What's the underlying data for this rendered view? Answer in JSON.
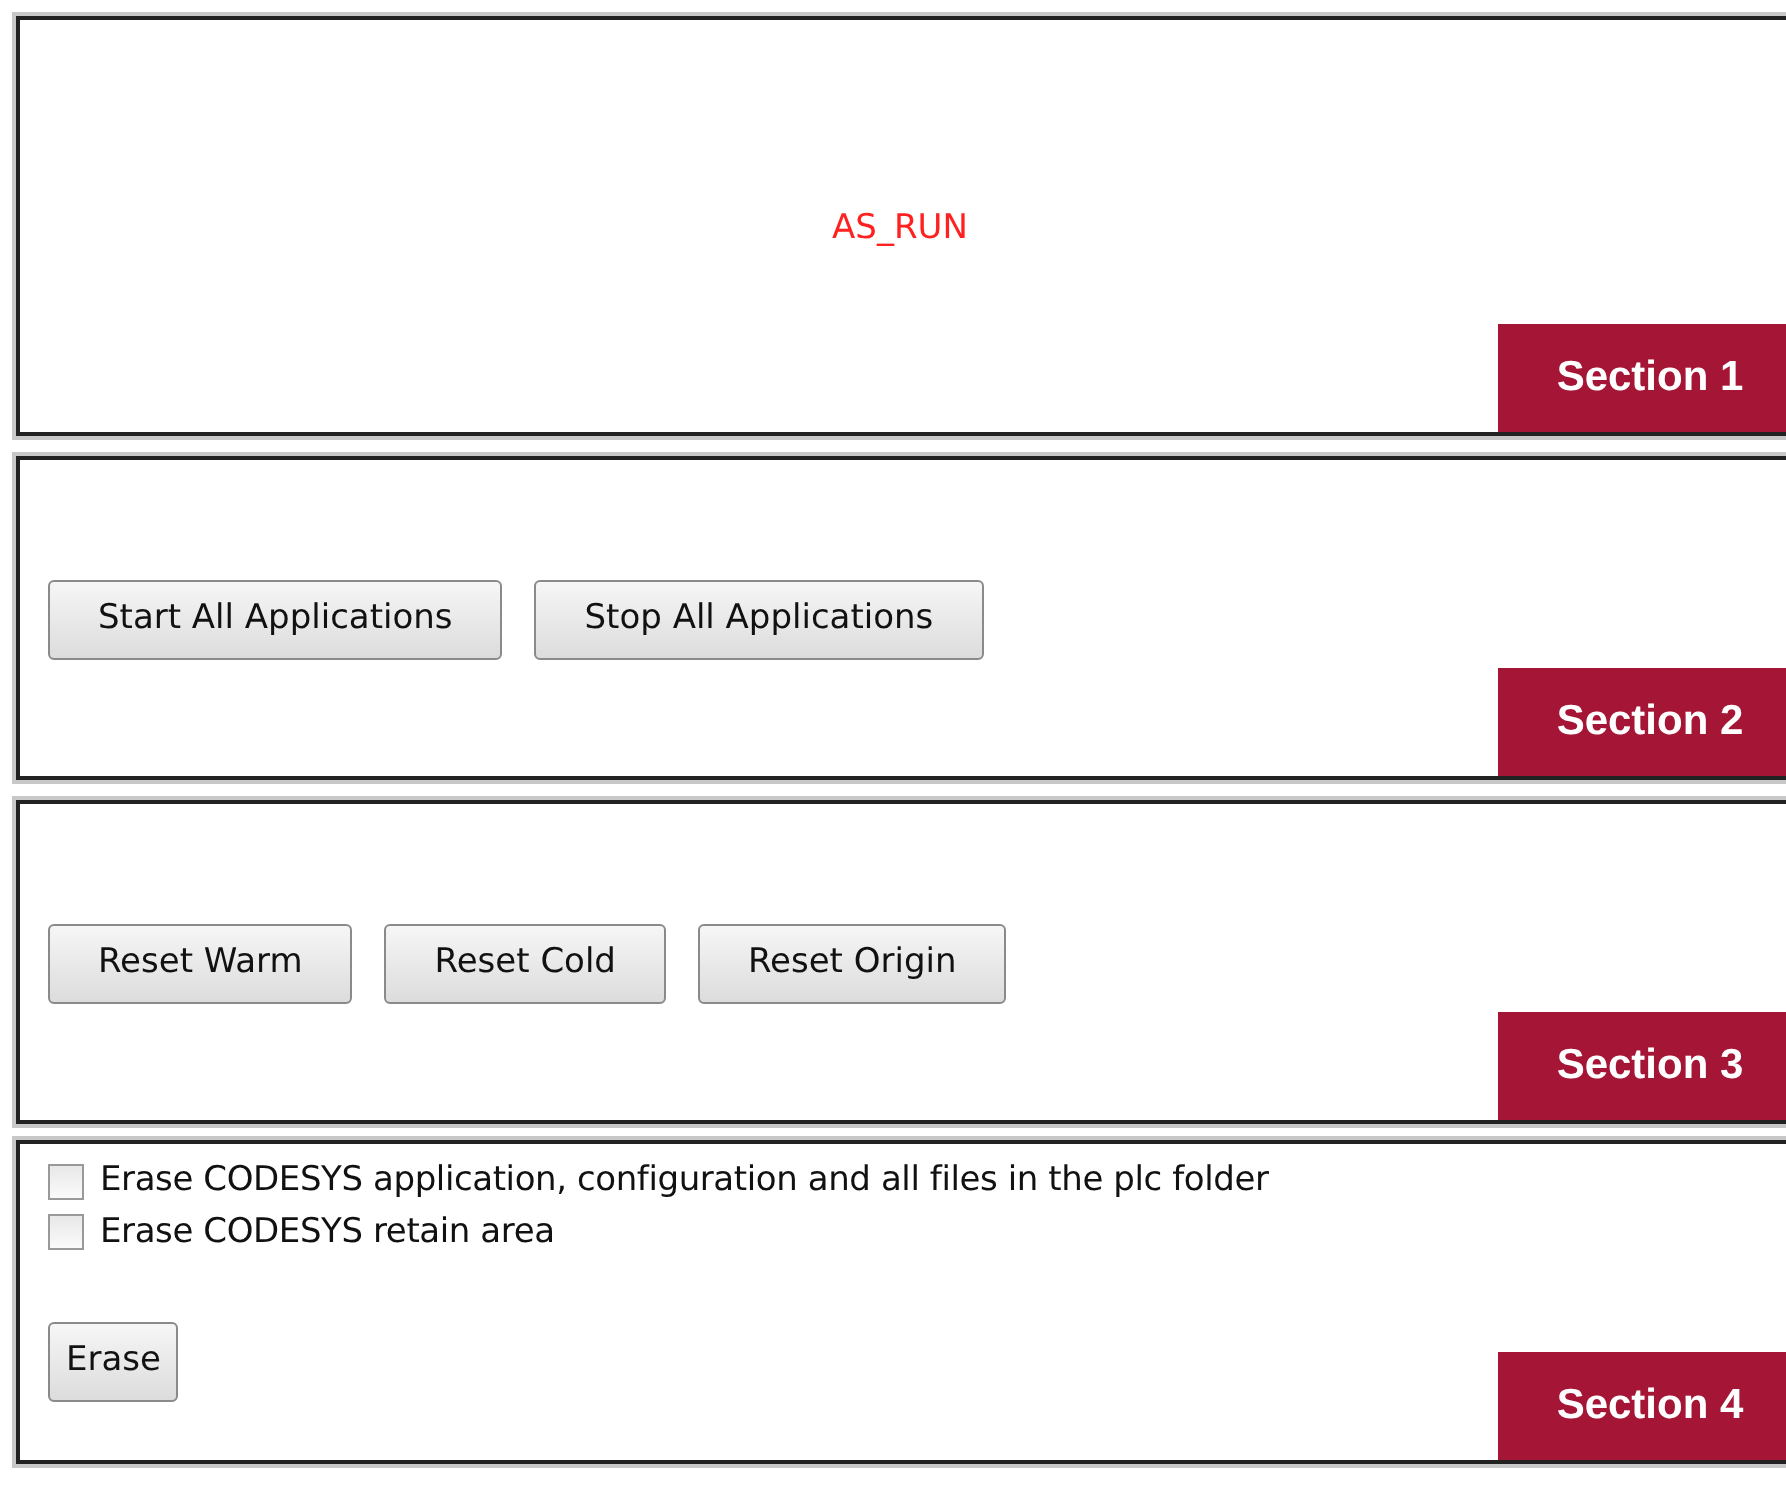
{
  "sections": [
    {
      "label": "Section 1",
      "kind": "status",
      "status": "AS_RUN"
    },
    {
      "label": "Section 2",
      "kind": "buttons",
      "buttons": [
        "Start All Applications",
        "Stop All Applications"
      ]
    },
    {
      "label": "Section 3",
      "kind": "buttons",
      "buttons": [
        "Reset Warm",
        "Reset Cold",
        "Reset Origin"
      ]
    },
    {
      "label": "Section 4",
      "kind": "erase",
      "options": [
        {
          "label": "Erase CODESYS application, configuration and all files in the plc folder",
          "checked": false
        },
        {
          "label": "Erase CODESYS retain area",
          "checked": false
        }
      ],
      "buttons": [
        "Erase"
      ]
    }
  ]
}
